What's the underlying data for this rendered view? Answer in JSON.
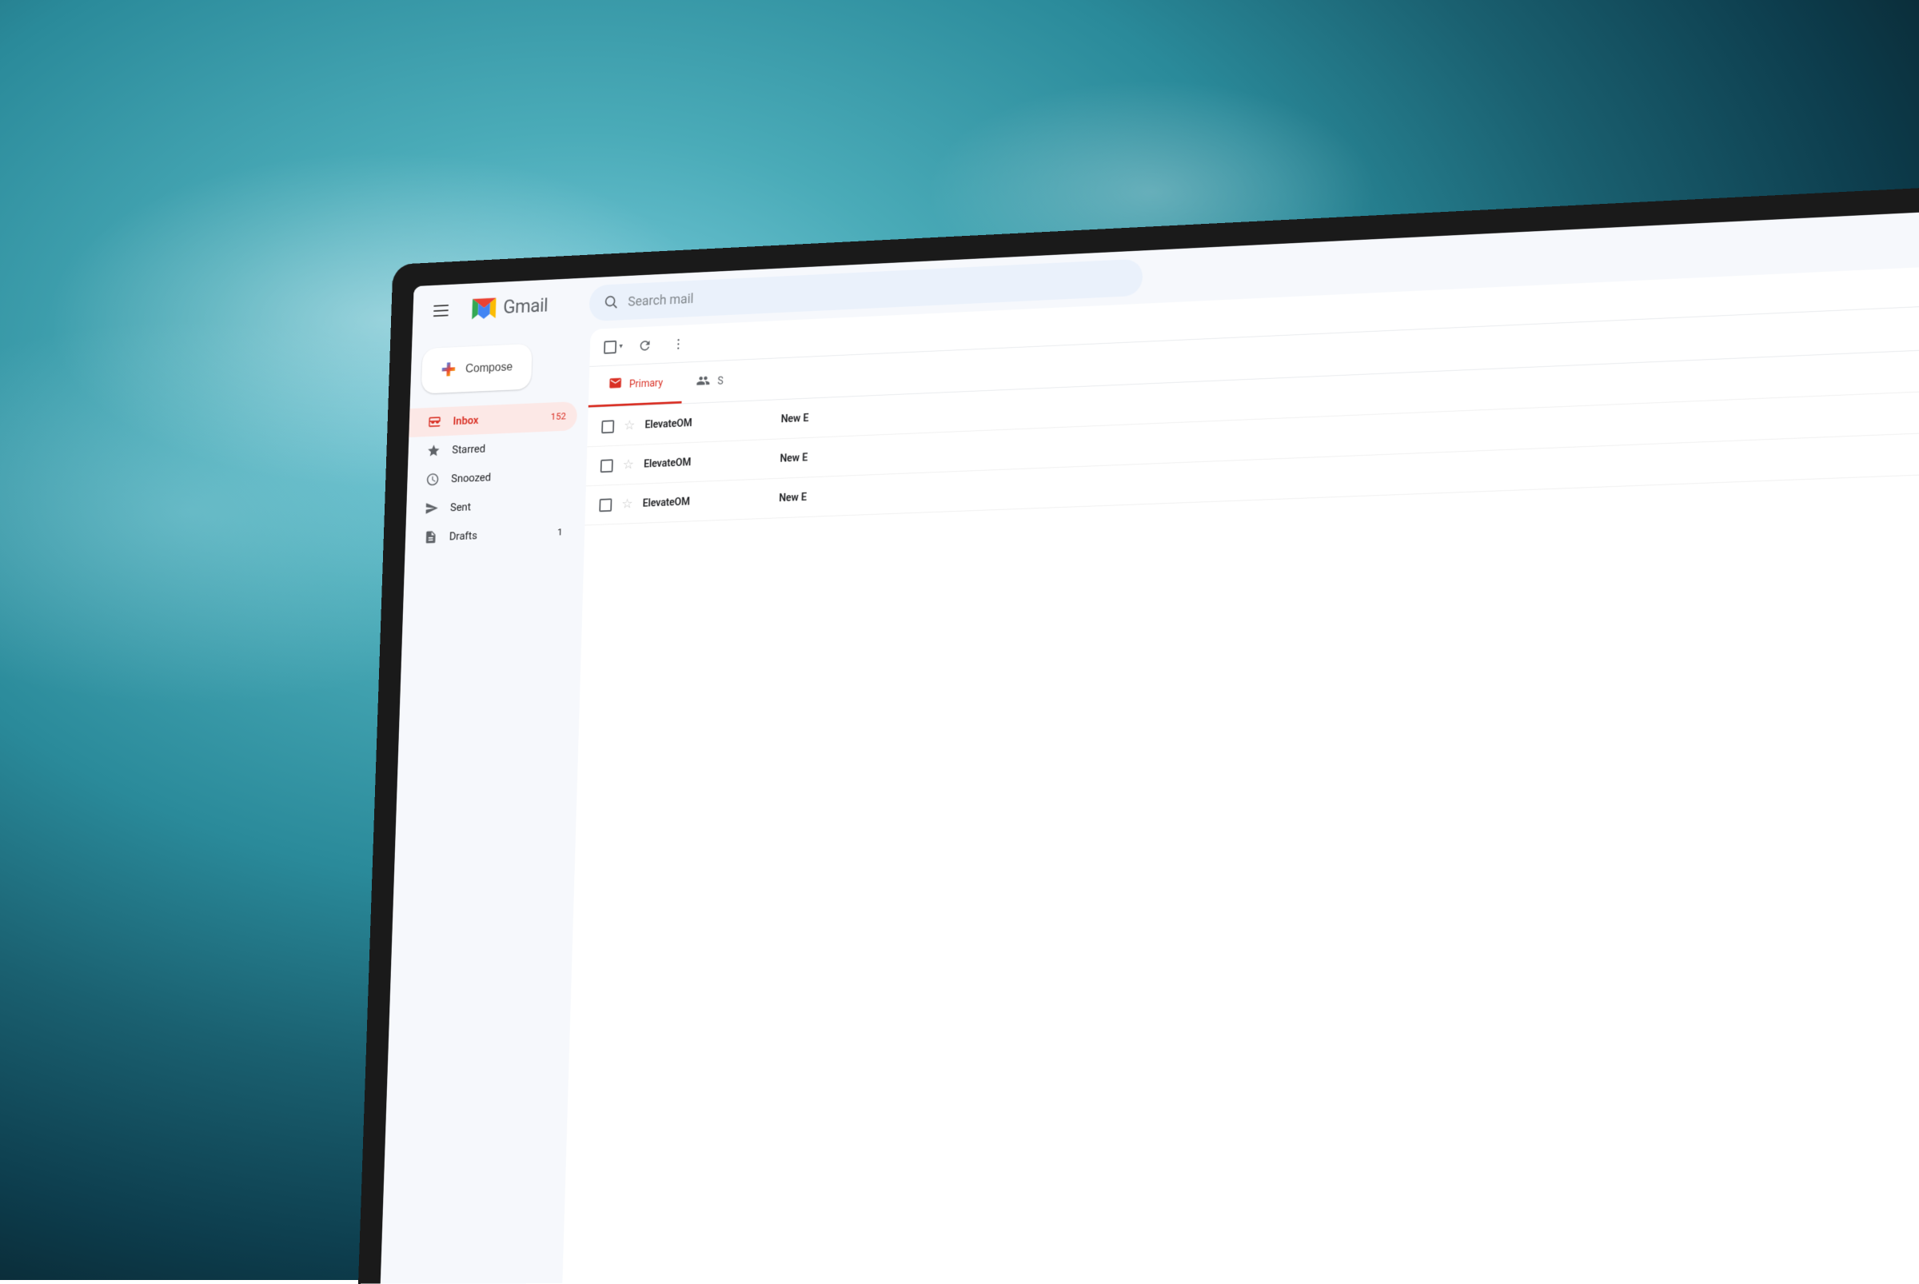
{
  "background": {
    "description": "Blurry teal ocean/cloud background"
  },
  "header": {
    "hamburger_label": "Main menu",
    "logo_text": "Gmail",
    "search_placeholder": "Search mail"
  },
  "sidebar": {
    "compose_label": "Compose",
    "nav_items": [
      {
        "id": "inbox",
        "label": "Inbox",
        "icon": "inbox",
        "badge": "152",
        "active": true
      },
      {
        "id": "starred",
        "label": "Starred",
        "icon": "star",
        "badge": "",
        "active": false
      },
      {
        "id": "snoozed",
        "label": "Snoozed",
        "icon": "clock",
        "badge": "",
        "active": false
      },
      {
        "id": "sent",
        "label": "Sent",
        "icon": "send",
        "badge": "",
        "active": false
      },
      {
        "id": "drafts",
        "label": "Drafts",
        "icon": "drafts",
        "badge": "1",
        "active": false
      }
    ]
  },
  "email_list": {
    "toolbar": {
      "select_all_label": "Select",
      "refresh_label": "Refresh",
      "more_label": "More"
    },
    "tabs": [
      {
        "id": "primary",
        "label": "Primary",
        "active": true
      },
      {
        "id": "social",
        "label": "S",
        "active": false
      }
    ],
    "emails": [
      {
        "sender": "ElevateOM",
        "subject": "New E",
        "snippet": "",
        "read": false
      },
      {
        "sender": "ElevateOM",
        "subject": "New E",
        "snippet": "",
        "read": false
      },
      {
        "sender": "ElevateOM",
        "subject": "New E",
        "snippet": "",
        "read": false
      }
    ]
  },
  "colors": {
    "gmail_red": "#d93025",
    "gmail_blue": "#4285f4",
    "gmail_green": "#34a853",
    "gmail_yellow": "#fbbc04",
    "active_bg": "#fce8e6",
    "search_bg": "#eaf1fb",
    "text_primary": "#202124",
    "text_secondary": "#5f6368"
  }
}
